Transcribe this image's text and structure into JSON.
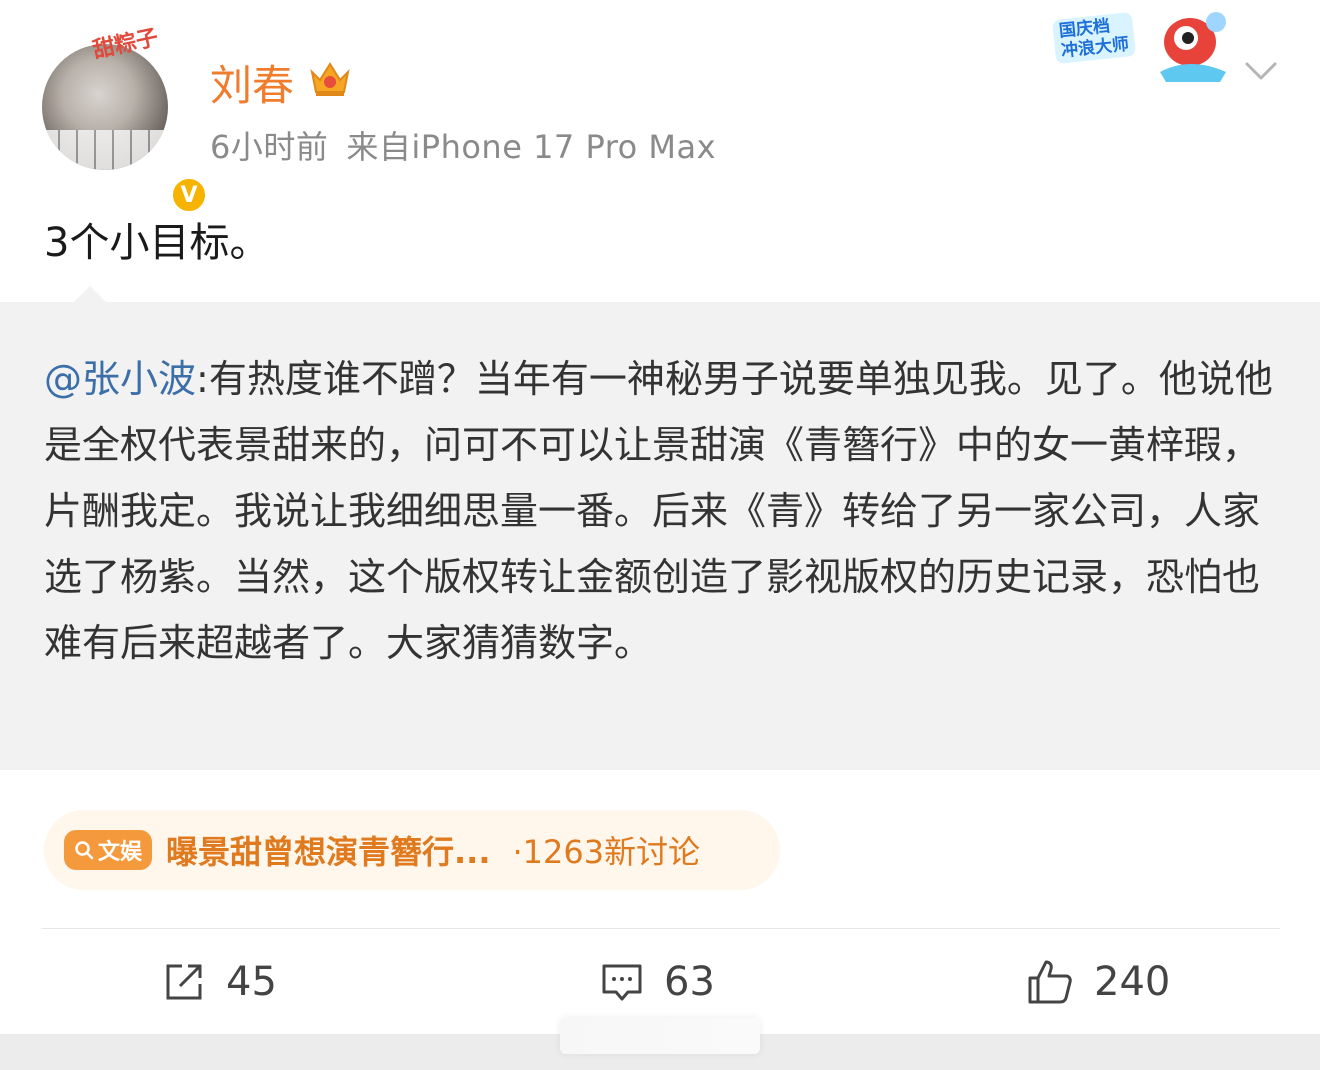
{
  "user": {
    "avatar_sticker": "甜粽子",
    "name": "刘春",
    "verified_badge": "V",
    "time": "6小时前",
    "source": "来自iPhone 17 Pro Max"
  },
  "promo": {
    "line1": "国庆档",
    "line2": "冲浪大师"
  },
  "post": {
    "text": "3个小目标。"
  },
  "quoted": {
    "mention": "@张小波",
    "text": ":有热度谁不蹭？当年有一神秘男子说要单独见我。见了。他说他是全权代表景甜来的，问可不可以让景甜演《青簪行》中的女一黄梓瑕，片酬我定。我说让我细细思量一番。后来《青》转给了另一家公司，人家选了杨紫。当然，这个版权转让金额创造了影视版权的历史记录，恐怕也难有后来超越者了。大家猜猜数字。"
  },
  "topic": {
    "chip_label": "文娱",
    "title": "曝景甜曾想演青簪行...",
    "count": "·1263新讨论"
  },
  "actions": {
    "repost_count": "45",
    "comment_count": "63",
    "like_count": "240"
  },
  "colors": {
    "username": "#f07c2e",
    "mention": "#3c6ea8",
    "topic_accent": "#e07a1f",
    "chip_bg": "#f59a3c",
    "quote_bg": "#f2f2f2"
  },
  "icons": [
    "chevron-down-icon",
    "crown-icon",
    "repost-icon",
    "comment-icon",
    "like-icon",
    "search-icon"
  ]
}
